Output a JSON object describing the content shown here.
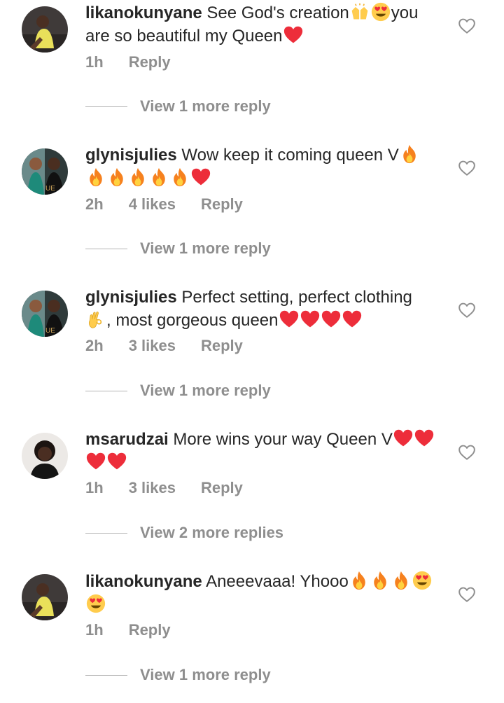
{
  "comments": [
    {
      "username": "likanokunyane",
      "text_1": " See God's creation",
      "text_2": "you are so beautiful my Queen",
      "emojis_mid": [
        "raising-hands",
        "heart-eyes"
      ],
      "emojis_end": [
        "red-heart"
      ],
      "time": "1h",
      "likes": "",
      "reply_label": "Reply",
      "more_label": "View 1 more reply",
      "avatar": "woman-yellow"
    },
    {
      "username": "glynisjulies",
      "text_1": " Wow keep it coming queen V",
      "text_2": "",
      "emojis_mid": [
        "fire"
      ],
      "emojis_end": [
        "fire",
        "fire",
        "fire",
        "fire",
        "fire",
        "red-heart"
      ],
      "time": "2h",
      "likes": "4 likes",
      "reply_label": "Reply",
      "more_label": "View 1 more reply",
      "avatar": "couple"
    },
    {
      "username": "glynisjulies",
      "text_1": " Perfect setting, perfect clothing ",
      "text_2": ", most gorgeous queen",
      "emojis_mid": [
        "ok-hand"
      ],
      "emojis_end": [
        "red-heart",
        "red-heart",
        "red-heart",
        "red-heart"
      ],
      "time": "2h",
      "likes": "3 likes",
      "reply_label": "Reply",
      "more_label": "View 1 more reply",
      "avatar": "couple"
    },
    {
      "username": "msarudzai",
      "text_1": " More wins your way Queen V",
      "text_2": "",
      "emojis_mid": [
        "red-heart"
      ],
      "emojis_end": [
        "red-heart",
        "red-heart",
        "red-heart"
      ],
      "time": "1h",
      "likes": "3 likes",
      "reply_label": "Reply",
      "more_label": "View 2 more replies",
      "avatar": "woman-dark"
    },
    {
      "username": "likanokunyane",
      "text_1": " Aneeevaaa! Yhooo",
      "text_2": "",
      "emojis_mid": [
        "fire",
        "fire",
        "fire"
      ],
      "emojis_end": [
        "heart-eyes",
        "heart-eyes"
      ],
      "time": "1h",
      "likes": "",
      "reply_label": "Reply",
      "more_label": "View 1 more reply",
      "avatar": "woman-yellow"
    }
  ],
  "colors": {
    "text": "#262626",
    "secondary": "#8e8e8e",
    "heart": "#ed2d3a",
    "fire": "#f6811e"
  }
}
